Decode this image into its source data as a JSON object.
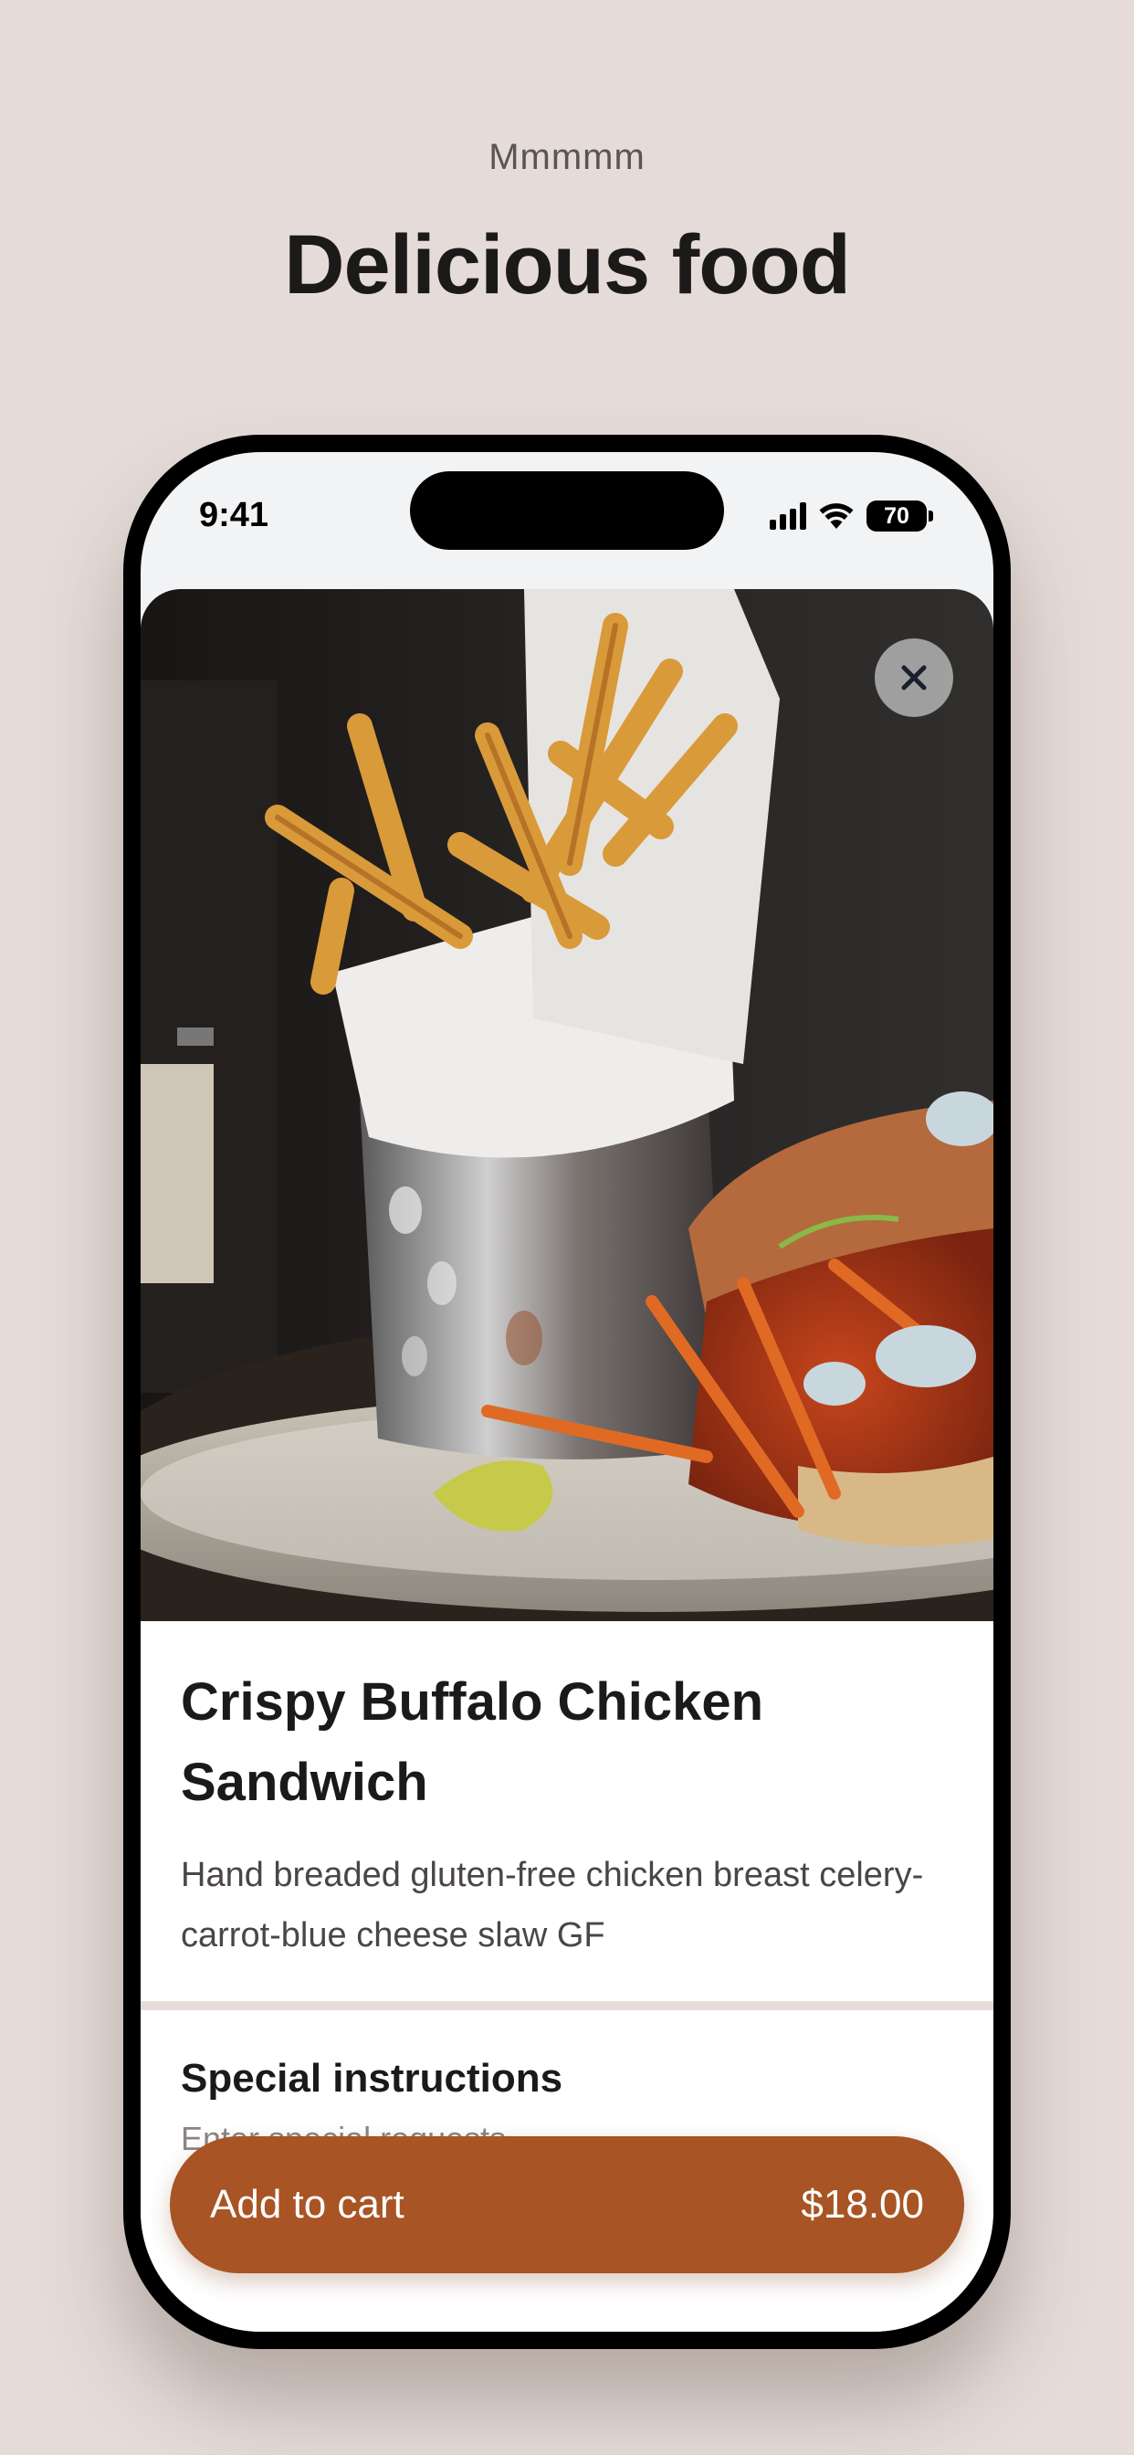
{
  "header": {
    "eyebrow": "Mmmmm",
    "headline": "Delicious food"
  },
  "status_bar": {
    "time": "9:41",
    "battery": "70",
    "icons": [
      "cellular-signal-icon",
      "wifi-icon",
      "battery-icon"
    ]
  },
  "item": {
    "photo_icon": "food-photo",
    "close_icon": "close-icon",
    "title": "Crispy Buffalo Chicken Sandwich",
    "description": "Hand breaded gluten-free chicken breast celery-carrot-blue cheese slaw GF"
  },
  "special_instructions": {
    "label": "Special instructions",
    "placeholder": "Enter special requests"
  },
  "cart_button": {
    "label": "Add to cart",
    "price": "$18.00"
  },
  "colors": {
    "background": "#e5dcd9",
    "accent": "#a85424",
    "text": "#1c1a19"
  }
}
